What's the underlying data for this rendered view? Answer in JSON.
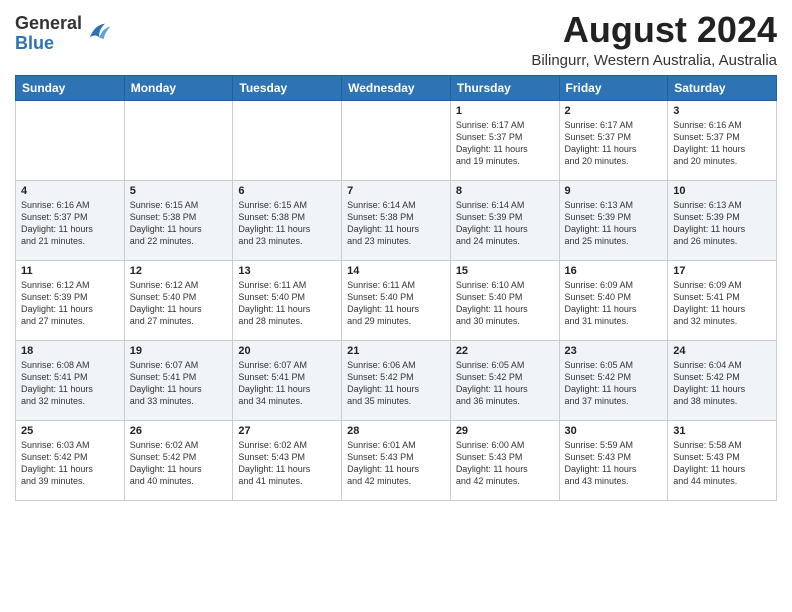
{
  "logo": {
    "general": "General",
    "blue": "Blue"
  },
  "title": "August 2024",
  "subtitle": "Bilingurr, Western Australia, Australia",
  "days_of_week": [
    "Sunday",
    "Monday",
    "Tuesday",
    "Wednesday",
    "Thursday",
    "Friday",
    "Saturday"
  ],
  "weeks": [
    [
      {
        "day": "",
        "detail": ""
      },
      {
        "day": "",
        "detail": ""
      },
      {
        "day": "",
        "detail": ""
      },
      {
        "day": "",
        "detail": ""
      },
      {
        "day": "1",
        "detail": "Sunrise: 6:17 AM\nSunset: 5:37 PM\nDaylight: 11 hours\nand 19 minutes."
      },
      {
        "day": "2",
        "detail": "Sunrise: 6:17 AM\nSunset: 5:37 PM\nDaylight: 11 hours\nand 20 minutes."
      },
      {
        "day": "3",
        "detail": "Sunrise: 6:16 AM\nSunset: 5:37 PM\nDaylight: 11 hours\nand 20 minutes."
      }
    ],
    [
      {
        "day": "4",
        "detail": "Sunrise: 6:16 AM\nSunset: 5:37 PM\nDaylight: 11 hours\nand 21 minutes."
      },
      {
        "day": "5",
        "detail": "Sunrise: 6:15 AM\nSunset: 5:38 PM\nDaylight: 11 hours\nand 22 minutes."
      },
      {
        "day": "6",
        "detail": "Sunrise: 6:15 AM\nSunset: 5:38 PM\nDaylight: 11 hours\nand 23 minutes."
      },
      {
        "day": "7",
        "detail": "Sunrise: 6:14 AM\nSunset: 5:38 PM\nDaylight: 11 hours\nand 23 minutes."
      },
      {
        "day": "8",
        "detail": "Sunrise: 6:14 AM\nSunset: 5:39 PM\nDaylight: 11 hours\nand 24 minutes."
      },
      {
        "day": "9",
        "detail": "Sunrise: 6:13 AM\nSunset: 5:39 PM\nDaylight: 11 hours\nand 25 minutes."
      },
      {
        "day": "10",
        "detail": "Sunrise: 6:13 AM\nSunset: 5:39 PM\nDaylight: 11 hours\nand 26 minutes."
      }
    ],
    [
      {
        "day": "11",
        "detail": "Sunrise: 6:12 AM\nSunset: 5:39 PM\nDaylight: 11 hours\nand 27 minutes."
      },
      {
        "day": "12",
        "detail": "Sunrise: 6:12 AM\nSunset: 5:40 PM\nDaylight: 11 hours\nand 27 minutes."
      },
      {
        "day": "13",
        "detail": "Sunrise: 6:11 AM\nSunset: 5:40 PM\nDaylight: 11 hours\nand 28 minutes."
      },
      {
        "day": "14",
        "detail": "Sunrise: 6:11 AM\nSunset: 5:40 PM\nDaylight: 11 hours\nand 29 minutes."
      },
      {
        "day": "15",
        "detail": "Sunrise: 6:10 AM\nSunset: 5:40 PM\nDaylight: 11 hours\nand 30 minutes."
      },
      {
        "day": "16",
        "detail": "Sunrise: 6:09 AM\nSunset: 5:40 PM\nDaylight: 11 hours\nand 31 minutes."
      },
      {
        "day": "17",
        "detail": "Sunrise: 6:09 AM\nSunset: 5:41 PM\nDaylight: 11 hours\nand 32 minutes."
      }
    ],
    [
      {
        "day": "18",
        "detail": "Sunrise: 6:08 AM\nSunset: 5:41 PM\nDaylight: 11 hours\nand 32 minutes."
      },
      {
        "day": "19",
        "detail": "Sunrise: 6:07 AM\nSunset: 5:41 PM\nDaylight: 11 hours\nand 33 minutes."
      },
      {
        "day": "20",
        "detail": "Sunrise: 6:07 AM\nSunset: 5:41 PM\nDaylight: 11 hours\nand 34 minutes."
      },
      {
        "day": "21",
        "detail": "Sunrise: 6:06 AM\nSunset: 5:42 PM\nDaylight: 11 hours\nand 35 minutes."
      },
      {
        "day": "22",
        "detail": "Sunrise: 6:05 AM\nSunset: 5:42 PM\nDaylight: 11 hours\nand 36 minutes."
      },
      {
        "day": "23",
        "detail": "Sunrise: 6:05 AM\nSunset: 5:42 PM\nDaylight: 11 hours\nand 37 minutes."
      },
      {
        "day": "24",
        "detail": "Sunrise: 6:04 AM\nSunset: 5:42 PM\nDaylight: 11 hours\nand 38 minutes."
      }
    ],
    [
      {
        "day": "25",
        "detail": "Sunrise: 6:03 AM\nSunset: 5:42 PM\nDaylight: 11 hours\nand 39 minutes."
      },
      {
        "day": "26",
        "detail": "Sunrise: 6:02 AM\nSunset: 5:42 PM\nDaylight: 11 hours\nand 40 minutes."
      },
      {
        "day": "27",
        "detail": "Sunrise: 6:02 AM\nSunset: 5:43 PM\nDaylight: 11 hours\nand 41 minutes."
      },
      {
        "day": "28",
        "detail": "Sunrise: 6:01 AM\nSunset: 5:43 PM\nDaylight: 11 hours\nand 42 minutes."
      },
      {
        "day": "29",
        "detail": "Sunrise: 6:00 AM\nSunset: 5:43 PM\nDaylight: 11 hours\nand 42 minutes."
      },
      {
        "day": "30",
        "detail": "Sunrise: 5:59 AM\nSunset: 5:43 PM\nDaylight: 11 hours\nand 43 minutes."
      },
      {
        "day": "31",
        "detail": "Sunrise: 5:58 AM\nSunset: 5:43 PM\nDaylight: 11 hours\nand 44 minutes."
      }
    ]
  ]
}
